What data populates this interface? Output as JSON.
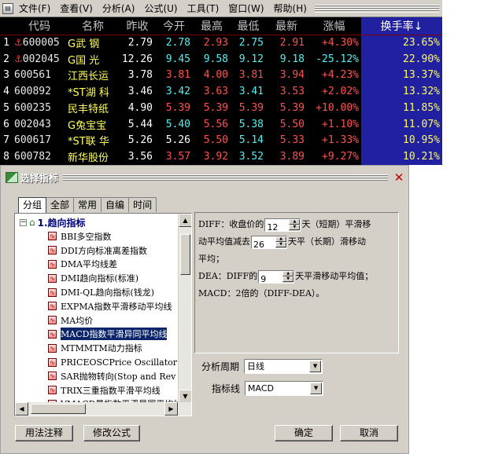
{
  "menu": {
    "items": [
      "文件(F)",
      "查看(V)",
      "分析(A)",
      "公式(U)",
      "工具(T)",
      "窗口(W)",
      "帮助(H)"
    ]
  },
  "table": {
    "headers": [
      "代码",
      "名称",
      "昨收",
      "今开",
      "最高",
      "最低",
      "最新",
      "涨幅",
      "换手率↓"
    ],
    "rows": [
      {
        "idx": "1",
        "flag": "⚓",
        "code": "600005",
        "name": "G武 钢",
        "prev": "2.79",
        "open": "2.78",
        "high": "2.93",
        "low": "2.75",
        "last": "2.91",
        "chg": "+4.30%",
        "turn": "23.65%"
      },
      {
        "idx": "2",
        "flag": "⚓",
        "code": "002045",
        "name": "G国 光",
        "prev": "12.26",
        "open": "9.45",
        "high": "9.58",
        "low": "9.12",
        "last": "9.18",
        "chg": "-25.12%",
        "turn": "22.90%"
      },
      {
        "idx": "3",
        "flag": "",
        "code": "600561",
        "name": "江西长运",
        "prev": "3.78",
        "open": "3.81",
        "high": "4.00",
        "low": "3.81",
        "last": "3.94",
        "chg": "+4.23%",
        "turn": "13.37%"
      },
      {
        "idx": "4",
        "flag": "",
        "code": "600892",
        "name": "*ST湖 科",
        "prev": "3.46",
        "open": "3.42",
        "high": "3.63",
        "low": "3.41",
        "last": "3.53",
        "chg": "+2.02%",
        "turn": "13.32%"
      },
      {
        "idx": "5",
        "flag": "",
        "code": "600235",
        "name": "民丰特纸",
        "prev": "4.90",
        "open": "5.39",
        "high": "5.39",
        "low": "5.39",
        "last": "5.39",
        "chg": "+10.00%",
        "turn": "11.85%"
      },
      {
        "idx": "6",
        "flag": "",
        "code": "002043",
        "name": "G兔宝宝",
        "prev": "5.44",
        "open": "5.40",
        "high": "5.56",
        "low": "5.38",
        "last": "5.50",
        "chg": "+1.10%",
        "turn": "11.07%"
      },
      {
        "idx": "7",
        "flag": "",
        "code": "600617",
        "name": "*ST联 华",
        "prev": "5.26",
        "open": "5.26",
        "high": "5.50",
        "low": "5.14",
        "last": "5.33",
        "chg": "+1.33%",
        "turn": "10.95%"
      },
      {
        "idx": "8",
        "flag": "",
        "code": "600782",
        "name": "新华股份",
        "prev": "3.56",
        "open": "3.57",
        "high": "3.92",
        "low": "3.52",
        "last": "3.89",
        "chg": "+9.27%",
        "turn": "10.21%"
      }
    ]
  },
  "dialog": {
    "title": "选择指标",
    "close_glyph": "✕",
    "tabs": [
      "分组",
      "全部",
      "常用",
      "自编",
      "时间"
    ],
    "tree_root": "1.趋向指标",
    "indicators": [
      "BBI多空指数",
      "DDI方向标准离差指数",
      "DMA平均线差",
      "DMI趋向指标(标准)",
      "DMI-QL趋向指标(钱龙)",
      "EXPMA指数平滑移动平均线",
      "MA均价",
      "MACD指数平滑异同平均线",
      "MTMMTM动力指标",
      "PRICEOSCPrice Oscillator",
      "SAR抛物转向(Stop and Rev",
      "TRIX三重指数平滑平均线",
      "VMACD量指数平滑异同平均线"
    ],
    "selected_index": 7,
    "description": {
      "line1_a": "DIFF：收盘价的",
      "param1": "12",
      "line1_b": "天（短期）平滑移",
      "line2_a": "动平均值减去",
      "param2": "26",
      "line2_b": "天平（长期）滑移动",
      "line3": "平均；",
      "line4_a": "DEA：DIFF的",
      "param3": "9",
      "line4_b": "天平滑移动平均值；",
      "line5": "MACD：2倍的（DIFF-DEA）。"
    },
    "period_label": "分析周期",
    "period_value": "日线",
    "indicator_label": "指标线",
    "indicator_value": "MACD",
    "buttons": {
      "usage": "用法注释",
      "modify": "修改公式",
      "ok": "确定",
      "cancel": "取消"
    }
  }
}
